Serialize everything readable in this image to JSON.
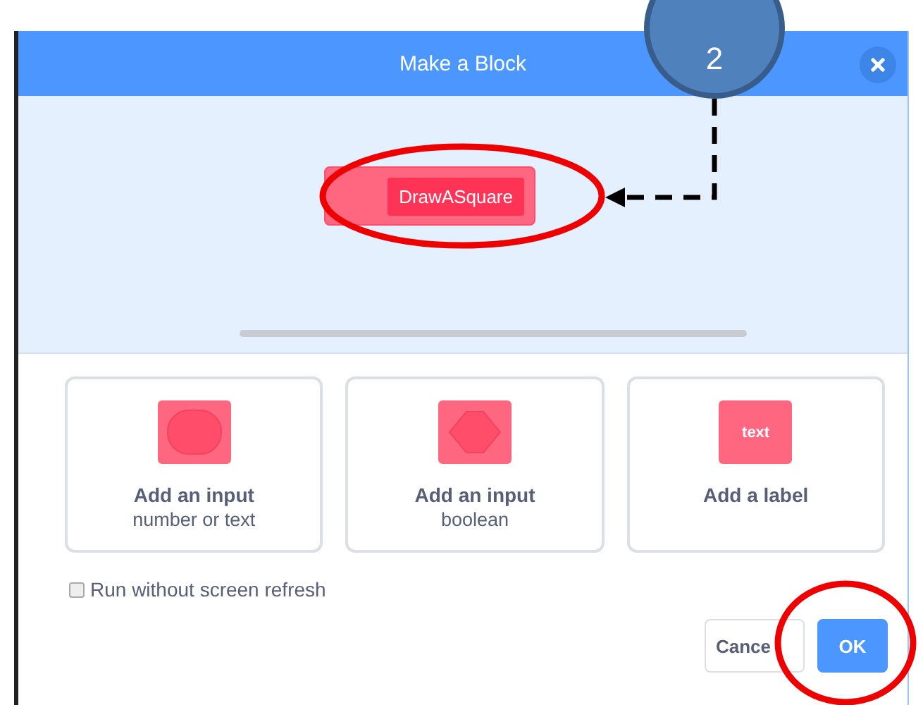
{
  "dialog": {
    "title": "Make a Block"
  },
  "preview": {
    "block_label": "DrawASquare"
  },
  "options": [
    {
      "kind": "round",
      "title": "Add an input",
      "subtitle": "number or text"
    },
    {
      "kind": "diamond",
      "title": "Add an input",
      "subtitle": "boolean"
    },
    {
      "kind": "label",
      "icon_text": "text",
      "title": "Add a label"
    }
  ],
  "checkbox": {
    "label": "Run without screen refresh",
    "checked": false
  },
  "buttons": [
    {
      "label": "Cance",
      "kind": "secondary"
    },
    {
      "label": "OK",
      "kind": "primary"
    }
  ],
  "annotation": {
    "step": "2"
  }
}
